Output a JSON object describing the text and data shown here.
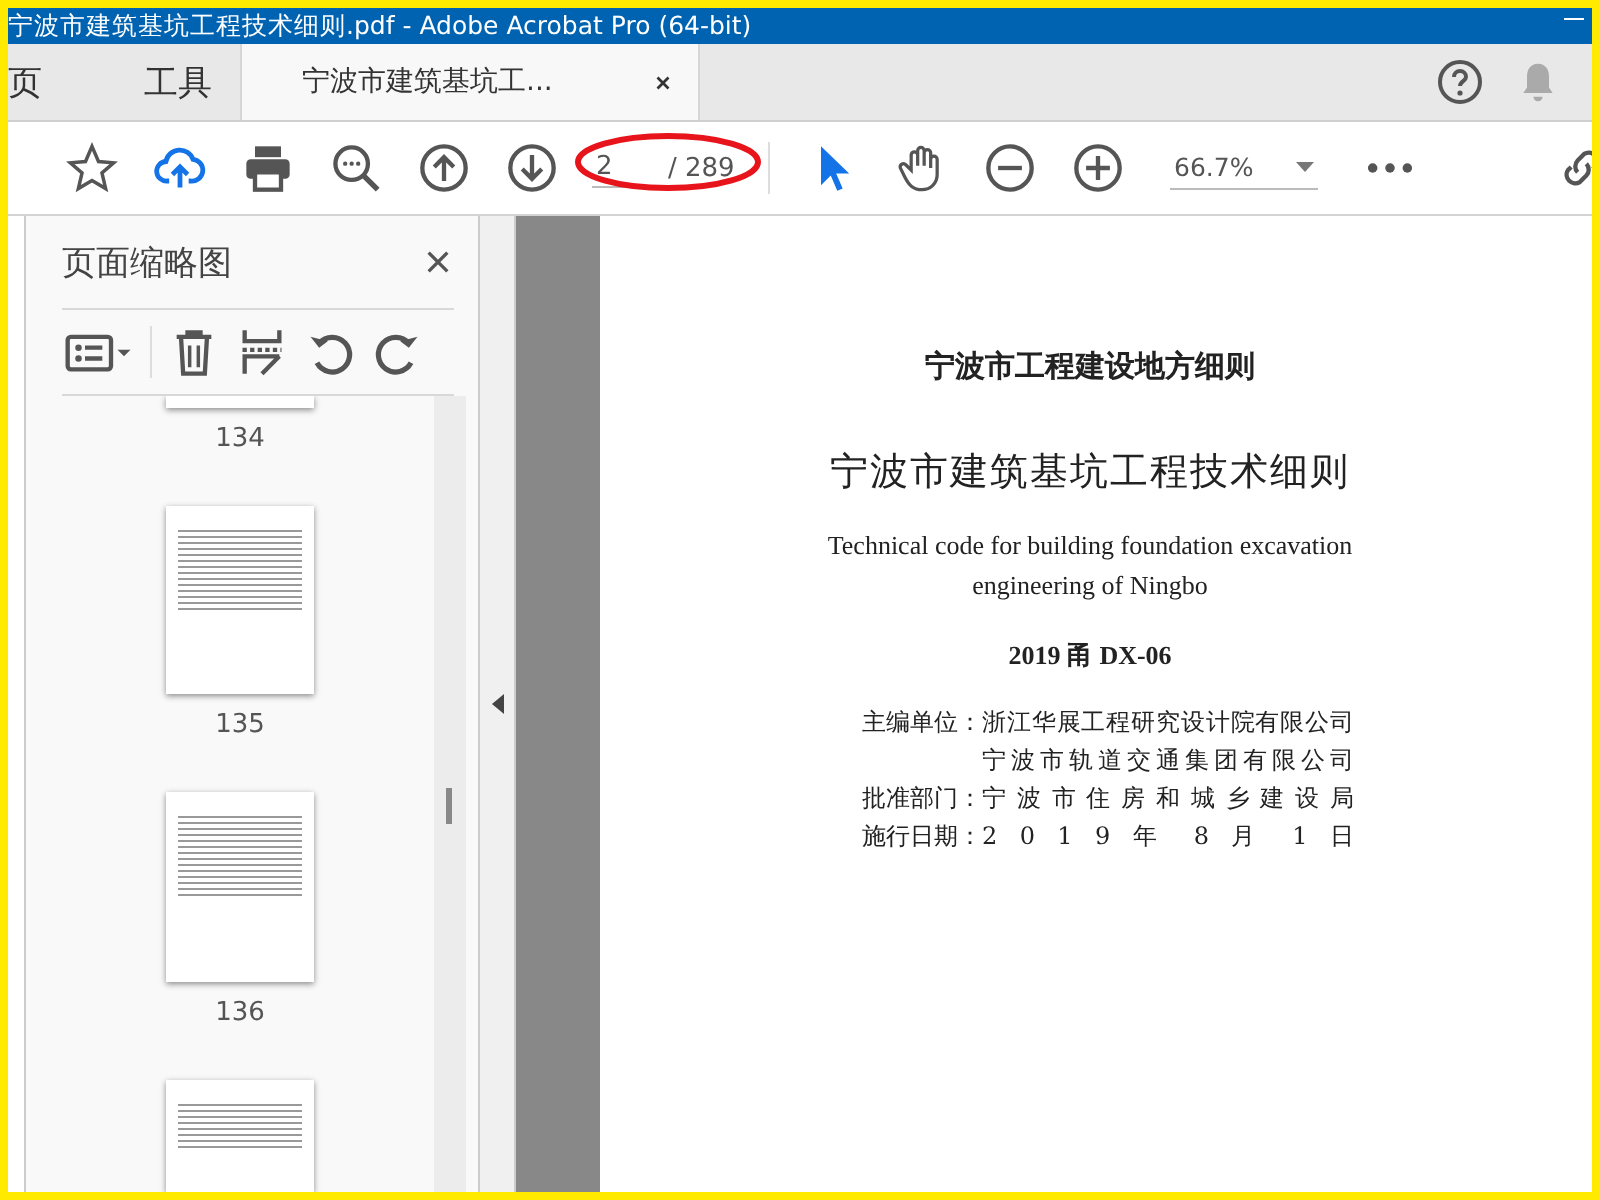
{
  "window": {
    "title": "宁波市建筑基坑工程技术细则.pdf - Adobe Acrobat Pro (64-bit)"
  },
  "tabs": [
    {
      "label": "页",
      "selected": false,
      "closable": false
    },
    {
      "label": "工具",
      "selected": false,
      "closable": false
    },
    {
      "label": "宁波市建筑基坑工...",
      "selected": true,
      "closable": true
    }
  ],
  "toolbar": {
    "page_input": {
      "value": "2"
    },
    "page_total": "/ 289",
    "zoom": {
      "value": "66.7%"
    }
  },
  "thumbnail_panel": {
    "title": "页面缩略图",
    "thumbnails": [
      {
        "label": "134",
        "kind": "cut-top"
      },
      {
        "label": "135",
        "kind": "full"
      },
      {
        "label": "136",
        "kind": "full"
      },
      {
        "kind": "cut-bottom"
      }
    ]
  },
  "document": {
    "series": "宁波市工程建设地方细则",
    "title": "宁波市建筑基坑工程技术细则",
    "english_title": "Technical code for building foundation excavation\nengineering of Ningbo",
    "code": "2019 甬 DX-06",
    "info": [
      {
        "label": "主编单位：",
        "values": [
          "浙江华展工程研究设计院有限公司",
          "宁波市轨道交通集团有限公司"
        ]
      },
      {
        "label": "批准部门：",
        "values": [
          "宁波市住房和城乡建设局"
        ]
      },
      {
        "label": "施行日期：",
        "values": [
          "2 0 1 9 年 8 月 1 日"
        ]
      }
    ]
  }
}
